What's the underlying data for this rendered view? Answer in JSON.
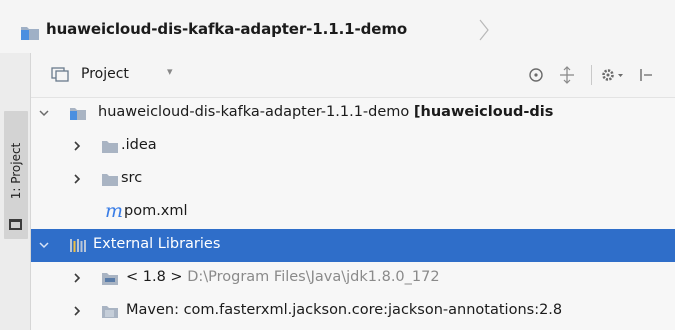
{
  "breadcrumb": {
    "project_name": "huaweicloud-dis-kafka-adapter-1.1.1-demo"
  },
  "side_strip": {
    "tab_label": "1: Project"
  },
  "panel": {
    "title": "Project",
    "caret": "▾",
    "toolbar": [
      "sync-icon",
      "collapse-all-icon",
      "gear-icon",
      "hide-icon"
    ]
  },
  "tree": {
    "root": {
      "label": "huaweicloud-dis-kafka-adapter-1.1.1-demo",
      "module": "[huaweicloud-dis"
    },
    "idea": {
      "label": ".idea"
    },
    "src": {
      "label": "src"
    },
    "pom": {
      "label": "pom.xml"
    },
    "external": {
      "label": "External Libraries"
    },
    "jdk": {
      "label": "< 1.8 >",
      "path": "D:\\Program Files\\Java\\jdk1.8.0_172"
    },
    "maven": {
      "label": "Maven: com.fasterxml.jackson.core:jackson-annotations:2.8"
    }
  },
  "colors": {
    "selection": "#2f6ec9",
    "folder": "#a9b4c3",
    "maven_icon": "#3a7de6"
  }
}
